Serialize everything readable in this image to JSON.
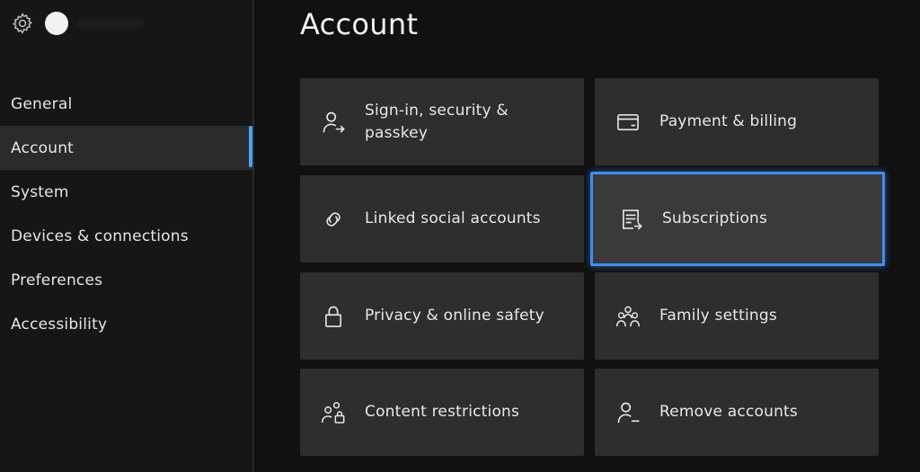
{
  "sidebar": {
    "nav": [
      {
        "label": "General"
      },
      {
        "label": "Account"
      },
      {
        "label": "System"
      },
      {
        "label": "Devices & connections"
      },
      {
        "label": "Preferences"
      },
      {
        "label": "Accessibility"
      }
    ],
    "active_index": 1
  },
  "page": {
    "title": "Account"
  },
  "tiles": [
    {
      "label": "Sign-in, security &\npasskey",
      "icon": "person-arrow-icon"
    },
    {
      "label": "Payment & billing",
      "icon": "card-icon"
    },
    {
      "label": "Linked social accounts",
      "icon": "link-icon"
    },
    {
      "label": "Subscriptions",
      "icon": "subscriptions-icon",
      "focused": true
    },
    {
      "label": "Privacy & online safety",
      "icon": "lock-icon"
    },
    {
      "label": "Family settings",
      "icon": "family-icon"
    },
    {
      "label": "Content restrictions",
      "icon": "people-lock-icon"
    },
    {
      "label": "Remove accounts",
      "icon": "person-remove-icon"
    }
  ],
  "colors": {
    "background": "#111111",
    "sidebar": "#161616",
    "tile": "#2e2e2e",
    "accent": "#3d8ef5"
  }
}
